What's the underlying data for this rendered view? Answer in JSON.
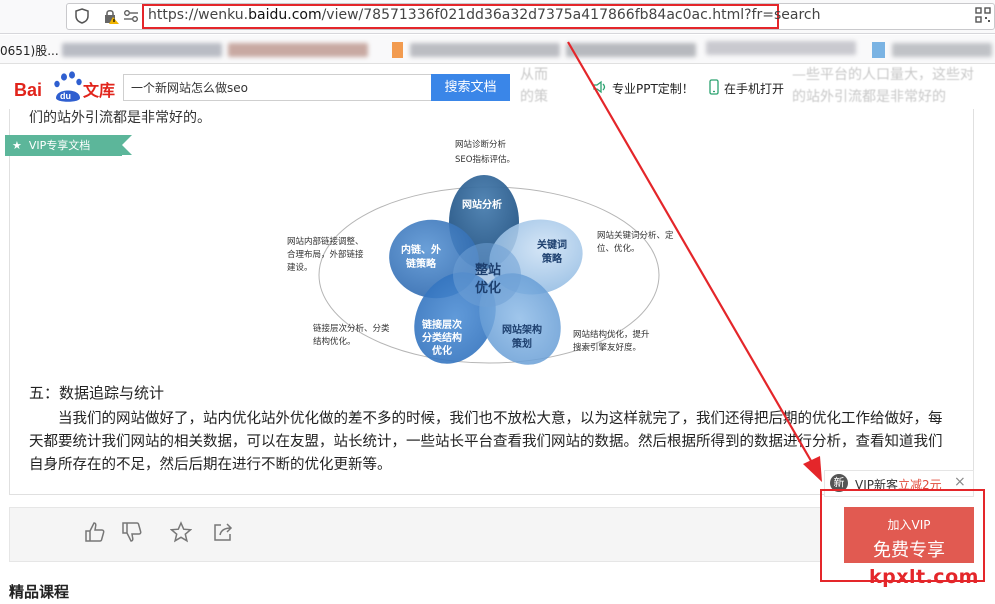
{
  "browser": {
    "url_prefix": "https://wenku.",
    "url_domain": "baidu.com",
    "url_path": "/view/78571336f021dd36a32d7375a417866fb84ac0ac.html?fr=search",
    "bookmark_first": "0651)股..."
  },
  "header": {
    "search_value": "一个新网站怎么做seo",
    "search_button": "搜索文档",
    "ppt_link": "专业PPT定制！",
    "mobile_link": "在手机打开"
  },
  "doc": {
    "intro_line": "们的站外引流都是非常好的。",
    "vip_ribbon": "VIP专享文档",
    "section_title": "五：数据追踪与统计",
    "paragraph": "当我们的网站做好了，站内优化站外优化做的差不多的时候，我们也不放松大意，以为这样就完了，我们还得把后期的优化工作给做好，每天都要统计我们网站的相关数据，可以在友盟，站长统计，一些站长平台查看我们网站的数据。然后根据所得到的数据进行分析，查看知道我们自身所存在的不足，然后后期在进行不断的优化更新等。"
  },
  "diagram": {
    "center": [
      "整站",
      "优化"
    ],
    "petal_top": "网站分析",
    "petal_right": [
      "关键词",
      "策略"
    ],
    "petal_left": [
      "内链、外",
      "链策略"
    ],
    "petal_bottom_left": [
      "链接层次",
      "分类结构",
      "优化"
    ],
    "petal_bottom_right": [
      "网站架构",
      "策划"
    ],
    "note_top": [
      "网站诊断分析",
      "SEO指标评估。"
    ],
    "note_right": [
      "网站关键词分析、定",
      "位、优化。"
    ],
    "note_left": [
      "网站内部链接调整、",
      "合理布局，外部链接",
      "建设。"
    ],
    "note_bottom_left": [
      "链接层次分析、分类",
      "结构优化。"
    ],
    "note_bottom_right": [
      "网站结构优化，提升",
      "搜索引擎友好度。"
    ]
  },
  "footer": {
    "section_heading": "精品课程"
  },
  "vip_promo": {
    "badge": "新",
    "banner_text": "VIP新客",
    "discount": "立减2元",
    "close": "×",
    "button_top": "加入VIP",
    "button_main": "免费专享"
  },
  "watermark": "kpxlt.com",
  "colors": {
    "accent_blue": "#3a86e8",
    "highlight_red": "#e4262a",
    "vip_green": "#5cb69a",
    "vip_button": "#e15a51"
  },
  "icons": [
    "shield-icon",
    "lock-icon",
    "permissions-icon",
    "qr-icon",
    "speaker-icon",
    "phone-icon",
    "thumbs-up-icon",
    "thumbs-down-icon",
    "star-icon",
    "share-icon"
  ]
}
